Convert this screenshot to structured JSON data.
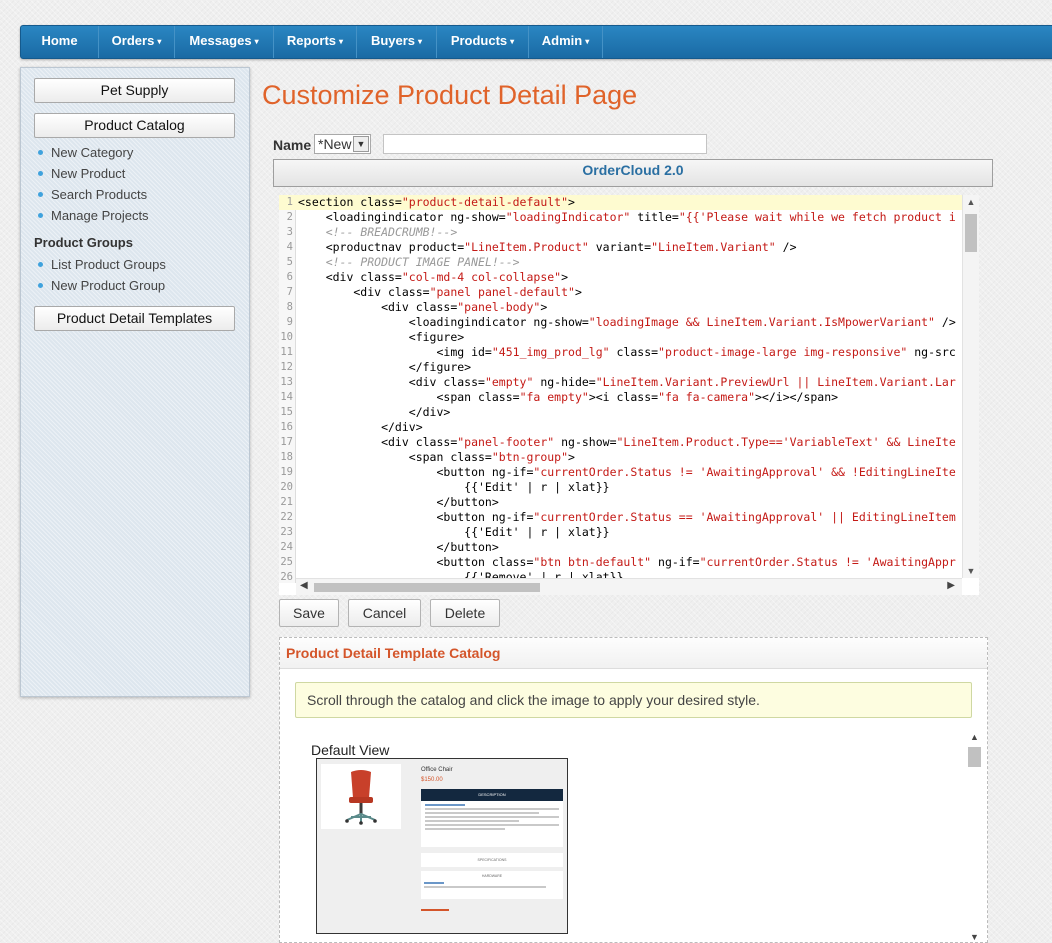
{
  "nav": {
    "items": [
      {
        "label": "Home",
        "dropdown": false
      },
      {
        "label": "Orders",
        "dropdown": true
      },
      {
        "label": "Messages",
        "dropdown": true
      },
      {
        "label": "Reports",
        "dropdown": true
      },
      {
        "label": "Buyers",
        "dropdown": true
      },
      {
        "label": "Products",
        "dropdown": true
      },
      {
        "label": "Admin",
        "dropdown": true
      }
    ],
    "caret": "▾"
  },
  "sidebar": {
    "btn_pet_supply": "Pet Supply",
    "btn_product_catalog": "Product Catalog",
    "catalog_links": [
      "New Category",
      "New Product",
      "Search Products",
      "Manage Projects"
    ],
    "groups_heading": "Product Groups",
    "group_links": [
      "List Product Groups",
      "New Product Group"
    ],
    "btn_templates": "Product Detail Templates"
  },
  "main": {
    "title": "Customize Product Detail Page",
    "name_label": "Name",
    "name_select_value": "*New",
    "name_input_value": "",
    "editor_header": "OrderCloud 2.0"
  },
  "code_lines": [
    [
      "<section class=",
      "\"product-detail-default\"",
      ">"
    ],
    [
      "    <loadingindicator ng-show=",
      "\"loadingIndicator\"",
      " title=",
      "\"{{'Please wait while we fetch product i"
    ],
    [
      "    ",
      "<!-- BREADCRUMB!-->"
    ],
    [
      "    <productnav product=",
      "\"LineItem.Product\"",
      " variant=",
      "\"LineItem.Variant\"",
      " />"
    ],
    [
      "    ",
      "<!-- PRODUCT IMAGE PANEL!-->"
    ],
    [
      "    <div class=",
      "\"col-md-4 col-collapse\"",
      ">"
    ],
    [
      "        <div class=",
      "\"panel panel-default\"",
      ">"
    ],
    [
      "            <div class=",
      "\"panel-body\"",
      ">"
    ],
    [
      "                <loadingindicator ng-show=",
      "\"loadingImage && LineItem.Variant.IsMpowerVariant\"",
      " />"
    ],
    [
      "                <figure>"
    ],
    [
      "                    <img id=",
      "\"451_img_prod_lg\"",
      " class=",
      "\"product-image-large img-responsive\"",
      " ng-src"
    ],
    [
      "                </figure>"
    ],
    [
      "                <div class=",
      "\"empty\"",
      " ng-hide=",
      "\"LineItem.Variant.PreviewUrl || LineItem.Variant.Lar"
    ],
    [
      "                    <span class=",
      "\"fa empty\"",
      "><i class=",
      "\"fa fa-camera\"",
      "></i></span>"
    ],
    [
      "                </div>"
    ],
    [
      "            </div>"
    ],
    [
      "            <div class=",
      "\"panel-footer\"",
      " ng-show=",
      "\"LineItem.Product.Type=='VariableText' && LineIte"
    ],
    [
      "                <span class=",
      "\"btn-group\"",
      ">"
    ],
    [
      "                    <button ng-if=",
      "\"currentOrder.Status != 'AwaitingApproval' && !EditingLineIte"
    ],
    [
      "                        {{'Edit' | r | xlat}}"
    ],
    [
      "                    </button>"
    ],
    [
      "                    <button ng-if=",
      "\"currentOrder.Status == 'AwaitingApproval' || EditingLineItem"
    ],
    [
      "                        {{'Edit' | r | xlat}}"
    ],
    [
      "                    </button>"
    ],
    [
      "                    <button class=",
      "\"btn btn-default\"",
      " ng-if=",
      "\"currentOrder.Status != 'AwaitingAppr"
    ],
    [
      "                        {{'Remove' | r | xlat}}"
    ],
    [
      ""
    ]
  ],
  "actions": {
    "save": "Save",
    "cancel": "Cancel",
    "delete": "Delete"
  },
  "catalog": {
    "heading": "Product Detail Template Catalog",
    "note": "Scroll through the catalog and click the image to apply your desired style.",
    "default_view_label": "Default View",
    "preview": {
      "product_name": "Office Chair",
      "price": "$150.00",
      "description_tab": "DESCRIPTION",
      "specifications_tab": "SPECIFICATIONS",
      "hardware_tab": "HARDWARE"
    }
  },
  "colors": {
    "nav_blue": "#1f76b3",
    "title_orange": "#e0632a",
    "link_dot": "#3fa2dd",
    "code_string": "#c41a16"
  }
}
